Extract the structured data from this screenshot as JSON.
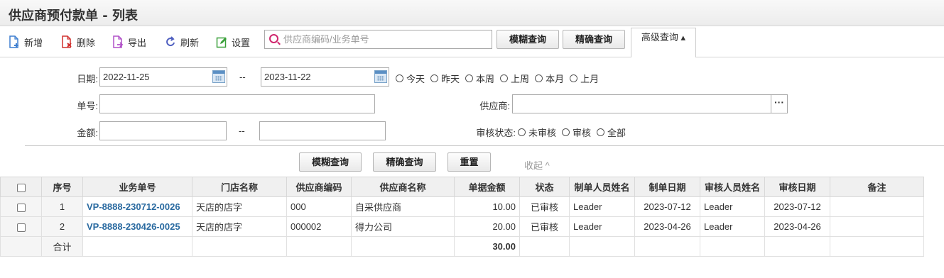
{
  "title": "供应商预付款单 - 列表",
  "toolbar": {
    "add": "新增",
    "delete": "删除",
    "export": "导出",
    "refresh": "刷新",
    "settings": "设置",
    "search_placeholder": "供应商编码/业务单号",
    "fuzzy": "模糊查询",
    "exact": "精确查询",
    "advanced": "高级查询 ▴"
  },
  "filters": {
    "date_label": "日期:",
    "date_from": "2022-11-25",
    "date_to": "2023-11-22",
    "range_sep": "--",
    "quick_dates": [
      "今天",
      "昨天",
      "本周",
      "上周",
      "本月",
      "上月"
    ],
    "bill_no_label": "单号:",
    "bill_no_value": "",
    "supplier_label": "供应商:",
    "supplier_value": "",
    "amount_label": "金额:",
    "amount_from": "",
    "amount_to": "",
    "audit_label": "审核状态:",
    "audit_options": [
      "未审核",
      "审核",
      "全部"
    ],
    "fuzzy": "模糊查询",
    "exact": "精确查询",
    "reset": "重置",
    "collapse": "收起 ^"
  },
  "table": {
    "columns": [
      "序号",
      "业务单号",
      "门店名称",
      "供应商编码",
      "供应商名称",
      "单据金额",
      "状态",
      "制单人员姓名",
      "制单日期",
      "审核人员姓名",
      "审核日期",
      "备注"
    ],
    "rows": [
      [
        "1",
        "VP-8888-230712-0026",
        "天店的店字",
        "000",
        "自采供应商",
        "10.00",
        "已审核",
        "Leader",
        "2023-07-12",
        "Leader",
        "2023-07-12",
        ""
      ],
      [
        "2",
        "VP-8888-230426-0025",
        "天店的店字",
        "000002",
        "得力公司",
        "20.00",
        "已审核",
        "Leader",
        "2023-04-26",
        "Leader",
        "2023-04-26",
        ""
      ]
    ],
    "total_label": "合计",
    "total_amount": "30.00"
  },
  "colors": {
    "link": "#2a6aa0",
    "add_icon": "#3f7fd0",
    "delete_icon": "#d0302e",
    "export_icon": "#b050c8",
    "refresh_icon": "#5060c0",
    "settings_icon": "#3aa03a"
  },
  "icons": [
    "add-doc-icon",
    "delete-doc-icon",
    "export-doc-icon",
    "refresh-icon",
    "settings-edit-icon",
    "search-icon",
    "calendar-icon",
    "ellipsis-icon"
  ]
}
